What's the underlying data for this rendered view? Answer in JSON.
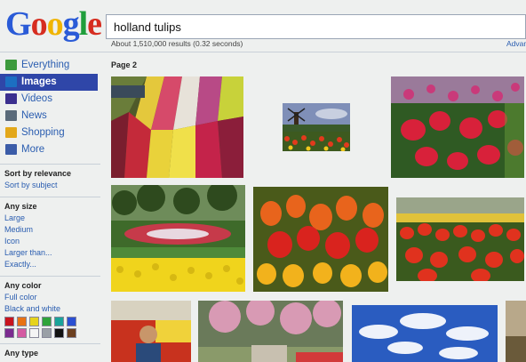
{
  "logo": {
    "letters": [
      "G",
      "o",
      "o",
      "g",
      "l",
      "e"
    ],
    "colors": [
      "#2a5bd7",
      "#d62d20",
      "#f0b400",
      "#2a5bd7",
      "#1f9e3b",
      "#d62d20"
    ]
  },
  "search": {
    "value": "holland tulips"
  },
  "stats": {
    "text": "About 1,510,000 results (0.32 seconds)",
    "advanced": "Advan"
  },
  "nav": [
    {
      "label": "Everything",
      "icon": "everything-icon",
      "color": "#3c9a3c"
    },
    {
      "label": "Images",
      "icon": "images-icon",
      "color": "#1c6fc2"
    },
    {
      "label": "Videos",
      "icon": "videos-icon",
      "color": "#3b2f8f"
    },
    {
      "label": "News",
      "icon": "news-icon",
      "color": "#5a6a7a"
    },
    {
      "label": "Shopping",
      "icon": "shopping-tag-icon",
      "color": "#e3a81a"
    },
    {
      "label": "More",
      "icon": "more-chevron-icon",
      "color": "#3b5ca8"
    }
  ],
  "sort": {
    "relevance": "Sort by relevance",
    "subject": "Sort by subject"
  },
  "size": {
    "title": "Any size",
    "options": [
      "Large",
      "Medium",
      "Icon",
      "Larger than...",
      "Exactly..."
    ]
  },
  "color": {
    "title": "Any color",
    "options": [
      "Full color",
      "Black and white"
    ],
    "swatches": [
      "#c8141e",
      "#e87214",
      "#e6d31c",
      "#2fa33a",
      "#1aa39a",
      "#2a4fd2",
      "#7b2b8f",
      "#d45aa2",
      "#f4f4f4",
      "#9aa0a6",
      "#111111",
      "#6b3f1f"
    ]
  },
  "type": {
    "title": "Any type"
  },
  "page": {
    "label": "Page 2"
  }
}
